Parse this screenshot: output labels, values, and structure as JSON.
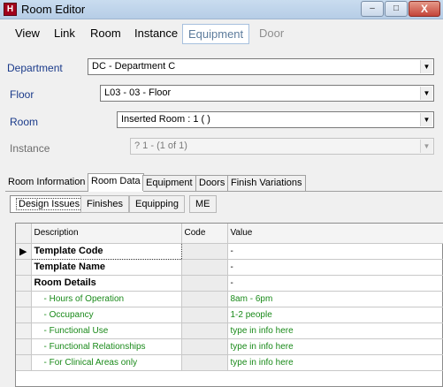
{
  "window": {
    "title": "Room Editor",
    "icon_letter": "H",
    "icon": "app-logo-icon",
    "controls": {
      "minimize": "–",
      "maximize": "□",
      "close": "X"
    }
  },
  "menu": {
    "view": "View",
    "link": "Link",
    "room": "Room",
    "instance": "Instance",
    "equipment": "Equipment",
    "door": "Door"
  },
  "fields": {
    "department": {
      "label": "Department",
      "value": "DC - Department C"
    },
    "floor": {
      "label": "Floor",
      "value": "L03 - 03 - Floor"
    },
    "room": {
      "label": "Room",
      "value": "Inserted Room : 1     (  )"
    },
    "instance": {
      "label": "Instance",
      "value": "? 1 -    (1 of 1)"
    }
  },
  "tabs": {
    "room_information": "Room Information",
    "room_data": "Room Data",
    "equipment": "Equipment",
    "doors": "Doors",
    "finish_variations": "Finish Variations"
  },
  "subtabs": {
    "design_issues": "Design Issues",
    "finishes": "Finishes",
    "equipping": "Equipping",
    "me": "ME"
  },
  "grid": {
    "columns": {
      "description": "Description",
      "code": "Code",
      "value": "Value"
    },
    "rows": [
      {
        "description": "Template Code",
        "code": "",
        "value": "-"
      },
      {
        "description": "Template Name",
        "code": "",
        "value": "-"
      },
      {
        "description": "Room Details",
        "code": "",
        "value": "-"
      },
      {
        "description": "- Hours of Operation",
        "code": "",
        "value": "8am - 6pm"
      },
      {
        "description": "- Occupancy",
        "code": "",
        "value": "1-2 people"
      },
      {
        "description": "- Functional Use",
        "code": "",
        "value": "type in info here"
      },
      {
        "description": "- Functional Relationships",
        "code": "",
        "value": "type in info here"
      },
      {
        "description": "- For Clinical Areas only",
        "code": "",
        "value": "type in info here"
      }
    ],
    "current_row_marker": "▶"
  },
  "colors": {
    "label_blue": "#1a3a8a",
    "detail_green": "#1a8a1a",
    "title_bar": "#c9dcef",
    "close_button": "#c4453a"
  }
}
